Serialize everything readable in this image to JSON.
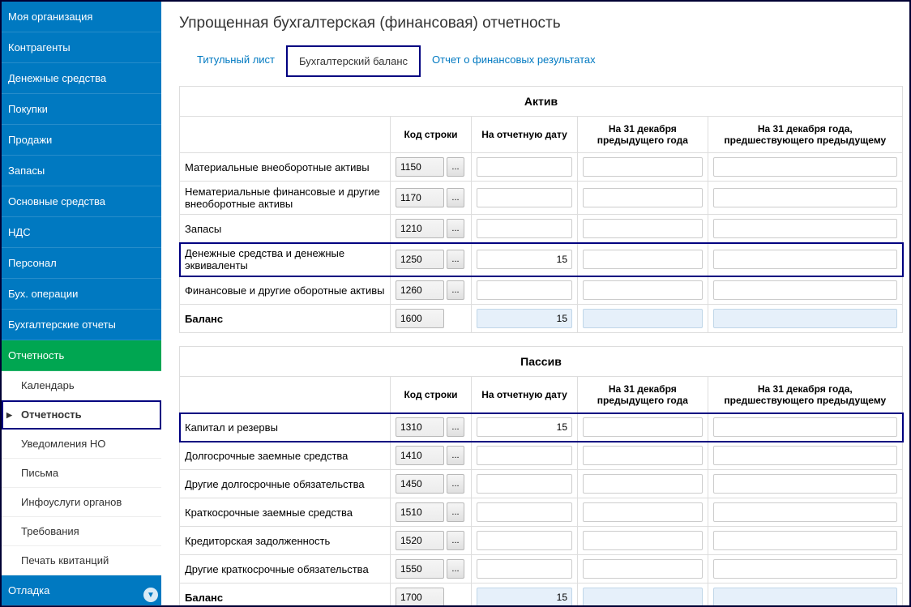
{
  "sidebar": {
    "items": [
      "Моя организация",
      "Контрагенты",
      "Денежные средства",
      "Покупки",
      "Продажи",
      "Запасы",
      "Основные средства",
      "НДС",
      "Персонал",
      "Бух. операции",
      "Бухгалтерские отчеты",
      "Отчетность"
    ],
    "sub_items": [
      "Календарь",
      "Отчетность",
      "Уведомления НО",
      "Письма",
      "Инфоуслуги органов",
      "Требования",
      "Печать квитанций"
    ],
    "after_items": [
      "Отладка"
    ]
  },
  "page": {
    "title": "Упрощенная бухгалтерская (финансовая) отчетность"
  },
  "tabs": [
    "Титульный лист",
    "Бухгалтерский баланс",
    "Отчет о финансовых результатах"
  ],
  "headers": {
    "aktiv": "Актив",
    "passiv": "Пассив",
    "code": "Код строки",
    "date": "На отчетную дату",
    "prev_year": "На 31 декабря предыдущего года",
    "prev_prev": "На 31 декабря года, предшествующего предыдущему"
  },
  "aktiv_rows": [
    {
      "label": "Материальные внеоборотные активы",
      "code": "1150",
      "val": "",
      "highlighted": false
    },
    {
      "label": "Нематериальные финансовые и другие внеоборотные активы",
      "code": "1170",
      "val": "",
      "highlighted": false
    },
    {
      "label": "Запасы",
      "code": "1210",
      "val": "",
      "highlighted": false
    },
    {
      "label": "Денежные средства и денежные эквиваленты",
      "code": "1250",
      "val": "15",
      "highlighted": true
    },
    {
      "label": "Финансовые и другие оборотные активы",
      "code": "1260",
      "val": "",
      "highlighted": false
    }
  ],
  "aktiv_balance": {
    "label": "Баланс",
    "code": "1600",
    "val": "15"
  },
  "passiv_rows": [
    {
      "label": "Капитал и резервы",
      "code": "1310",
      "val": "15",
      "highlighted": true
    },
    {
      "label": "Долгосрочные заемные средства",
      "code": "1410",
      "val": "",
      "highlighted": false
    },
    {
      "label": "Другие долгосрочные обязательства",
      "code": "1450",
      "val": "",
      "highlighted": false
    },
    {
      "label": "Краткосрочные заемные средства",
      "code": "1510",
      "val": "",
      "highlighted": false
    },
    {
      "label": "Кредиторская задолженность",
      "code": "1520",
      "val": "",
      "highlighted": false
    },
    {
      "label": "Другие краткосрочные обязательства",
      "code": "1550",
      "val": "",
      "highlighted": false
    }
  ],
  "passiv_balance": {
    "label": "Баланс",
    "code": "1700",
    "val": "15"
  },
  "ellipsis": "..."
}
